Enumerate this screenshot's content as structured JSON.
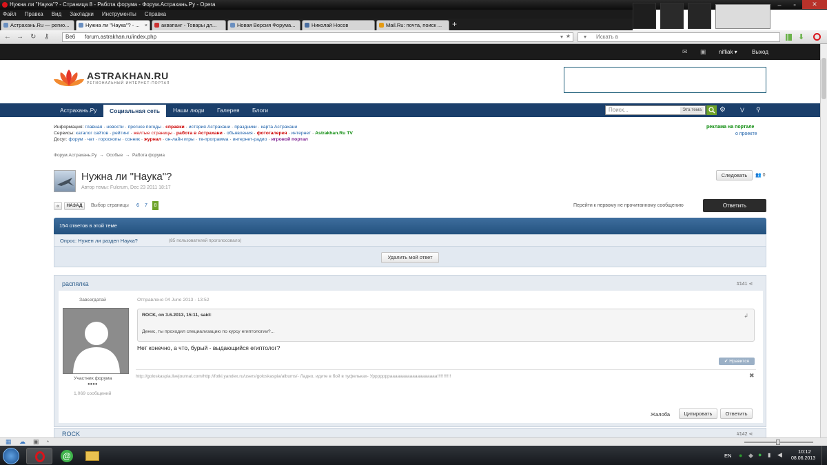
{
  "window": {
    "title": "Нужна ли \"Наука\"? - Страница 8 - Работа форума - Форум.Астрахань.Ру - Opera"
  },
  "menu": [
    "Файл",
    "Правка",
    "Вид",
    "Закладки",
    "Инструменты",
    "Справка"
  ],
  "tabs": [
    {
      "label": "Астрахань.Ru — регио..."
    },
    {
      "label": "Нужна ли \"Наука\"? - ..."
    },
    {
      "label": "аквапанг - Товары дл..."
    },
    {
      "label": "Новая Версия Форума..."
    },
    {
      "label": "Николай Носов"
    },
    {
      "label": "Mail.Ru: почта, поиск ..."
    }
  ],
  "address": {
    "web_label": "Веб",
    "url": "forum.astrakhan.ru/index.php",
    "search_placeholder": "Искать в"
  },
  "userbar": {
    "username": "nifliak",
    "logout": "Выход"
  },
  "logo": {
    "name": "ASTRAKHAN.RU",
    "tagline": "РЕГИОНАЛЬНЫЙ ИНТЕРНЕТ-ПОРТАЛ"
  },
  "nav": {
    "items": [
      "Астрахань.Ру",
      "Социальная сеть",
      "Наши люди",
      "Галерея",
      "Блоги"
    ],
    "search_placeholder": "Поиск...",
    "search_scope": "Эта тема",
    "v_label": "V"
  },
  "links": {
    "info_label": "Информация:",
    "info": [
      "главная",
      "новости",
      "прогноз погоды",
      "справки",
      "история Астрахани",
      "праздники",
      "карта Астрахани"
    ],
    "services_label": "Сервисы:",
    "services": [
      "каталог сайтов",
      "рейтинг",
      "желтые страницы",
      "работа в Астрахани",
      "объявления",
      "фотогалерея",
      "интернет",
      "Astrakhan.Ru TV"
    ],
    "leisure_label": "Досуг:",
    "leisure": [
      "форум",
      "чат",
      "гороскопы",
      "сонник",
      "журнал",
      "он-лайн игры",
      "тв-программа",
      "интернет-радио",
      "игровой портал"
    ],
    "ad": "реклама на портале",
    "about": "о проекте"
  },
  "breadcrumb": [
    "Форум.Астрахань.Ру",
    "Особые",
    "Работа форума"
  ],
  "topic": {
    "title": "Нужна ли \"Наука\"?",
    "meta": "Автор темы: Fulcrum, Dec 23 2011 18:17",
    "follow": "Следовать",
    "follow_count": "0"
  },
  "pagination": {
    "back": "НАЗАД",
    "label": "Выбор страницы",
    "pages": [
      "6",
      "7",
      "8"
    ],
    "current": "8",
    "first_unread": "Перейти к первому не прочитанному сообщению",
    "reply": "Ответить"
  },
  "thread": {
    "reply_count": "154 ответов в этой теме",
    "poll": "Опрос: Нужен ли раздел Наука?",
    "poll_votes": "(85 пользователей проголосовало)",
    "delete_vote": "Удалить мой ответ"
  },
  "posts": [
    {
      "author": "распялка",
      "number": "#141",
      "user_title": "Завсегдатай",
      "rank": "Участник форума",
      "rank_dots": "●●●●",
      "post_count": "1,069 сообщений",
      "date": "Отправлено 04 June 2013 - 13:52",
      "quote_author": "ROCK, on 3.6.2013, 15:11, said:",
      "quote_text": "Денис, ты проходил специализацию по курсу египтологии?...",
      "text": "Нет конечно, а что, бурый - выдающийся египтолог?",
      "like": "Нравится",
      "signature": "http://goloskaspia.livejournal.com/http://fotki.yandex.ru/users/goloskaspia/albums/- Ладно, идите в бой в туфельках- Урррррррааааааааааааааааааа!!!!!!!!!!!",
      "report": "Жалоба",
      "quote_btn": "Цитировать",
      "reply_btn": "Ответить"
    },
    {
      "author": "ROCK",
      "number": "#142"
    }
  ],
  "taskbar": {
    "lang": "EN",
    "time": "10:12",
    "date": "08.06.2013"
  },
  "colors": {
    "nav": "#1b3f6b",
    "accent_green": "#6fa32a",
    "header_blue": "#24527f"
  }
}
